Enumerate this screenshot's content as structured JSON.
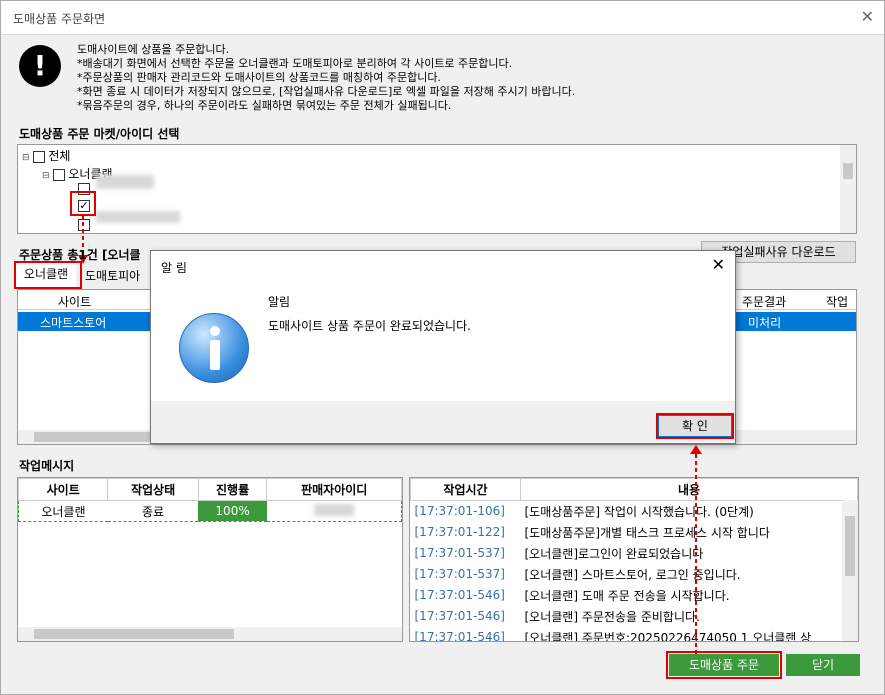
{
  "window": {
    "title": "도매상품 주문화면"
  },
  "notice": {
    "lines": [
      "도매사이트에 상품을 주문합니다.",
      "*배송대기 화면에서 선택한 주문을 오너클랜과 도매토피아로 분리하여 각 사이트로 주문합니다.",
      "*주문상품의 판매자 관리코드와 도매사이트의 상품코드를 매칭하여 주문합니다.",
      "*화면 종료 시 데이터가 저장되지 않으므로, [작업실패사유 다운로드]로 엑셀 파일을 저장해 주시기 바랍니다.",
      "*묶음주문의 경우, 하나의 주문이라도 실패하면 묶여있는 주문 전체가 실패됩니다."
    ]
  },
  "market_section": {
    "title": "도매상품 주문 마켓/아이디 선택"
  },
  "tree": {
    "all": "전체",
    "ownerclan": "오너클랜"
  },
  "orders_section": {
    "title": "주문상품 총1건 [오너클"
  },
  "download_button": "작업실패사유 다운로드",
  "tabs": [
    {
      "label": "오너클랜"
    },
    {
      "label": "도매토피아"
    }
  ],
  "orders_table": {
    "headers": [
      "사이트",
      "주문결과",
      "작업실"
    ],
    "rows": [
      {
        "site": "스마트스토어",
        "result": "미처리"
      }
    ]
  },
  "work_section": {
    "title": "작업메시지"
  },
  "status_table": {
    "headers": [
      "사이트",
      "작업상태",
      "진행률",
      "판매자아이디"
    ],
    "rows": [
      {
        "site": "오너클랜",
        "status": "종료",
        "progress": "100%",
        "progress_value": 1.0
      }
    ]
  },
  "log_table": {
    "headers": [
      "작업시간",
      "내용"
    ],
    "rows": [
      {
        "time": "[17:37:01-106]",
        "content": "[도매상품주문] 작업이 시작했습니다. (0단계)"
      },
      {
        "time": "[17:37:01-122]",
        "content": "[도매상품주문]개별 태스크 프로세스 시작 합니다"
      },
      {
        "time": "[17:37:01-537]",
        "content": "[오너클랜]로그인이 완료되었습니다"
      },
      {
        "time": "[17:37:01-537]",
        "content": "[오너클랜] 스마트스토어,           로그인 중입니다."
      },
      {
        "time": "[17:37:01-546]",
        "content": "[오너클랜] 도매 주문 전송을 시작합니다."
      },
      {
        "time": "[17:37:01-546]",
        "content": "[오너클랜] 주문전송을 준비합니다."
      },
      {
        "time": "[17:37:01-546]",
        "content": "[오너클랜] 주문번호:20250226474050 1 오너클랜 상"
      }
    ]
  },
  "bottom_buttons": {
    "order": "도매상품 주문",
    "close": "닫기"
  },
  "dialog": {
    "title": "알 림",
    "heading": "알림",
    "message": "도매사이트 상품 주문이 완료되었습니다.",
    "ok": "확 인"
  },
  "colors": {
    "accent_green": "#3c9a3c",
    "selection_blue": "#0078d7",
    "highlight_red": "#e00000"
  }
}
